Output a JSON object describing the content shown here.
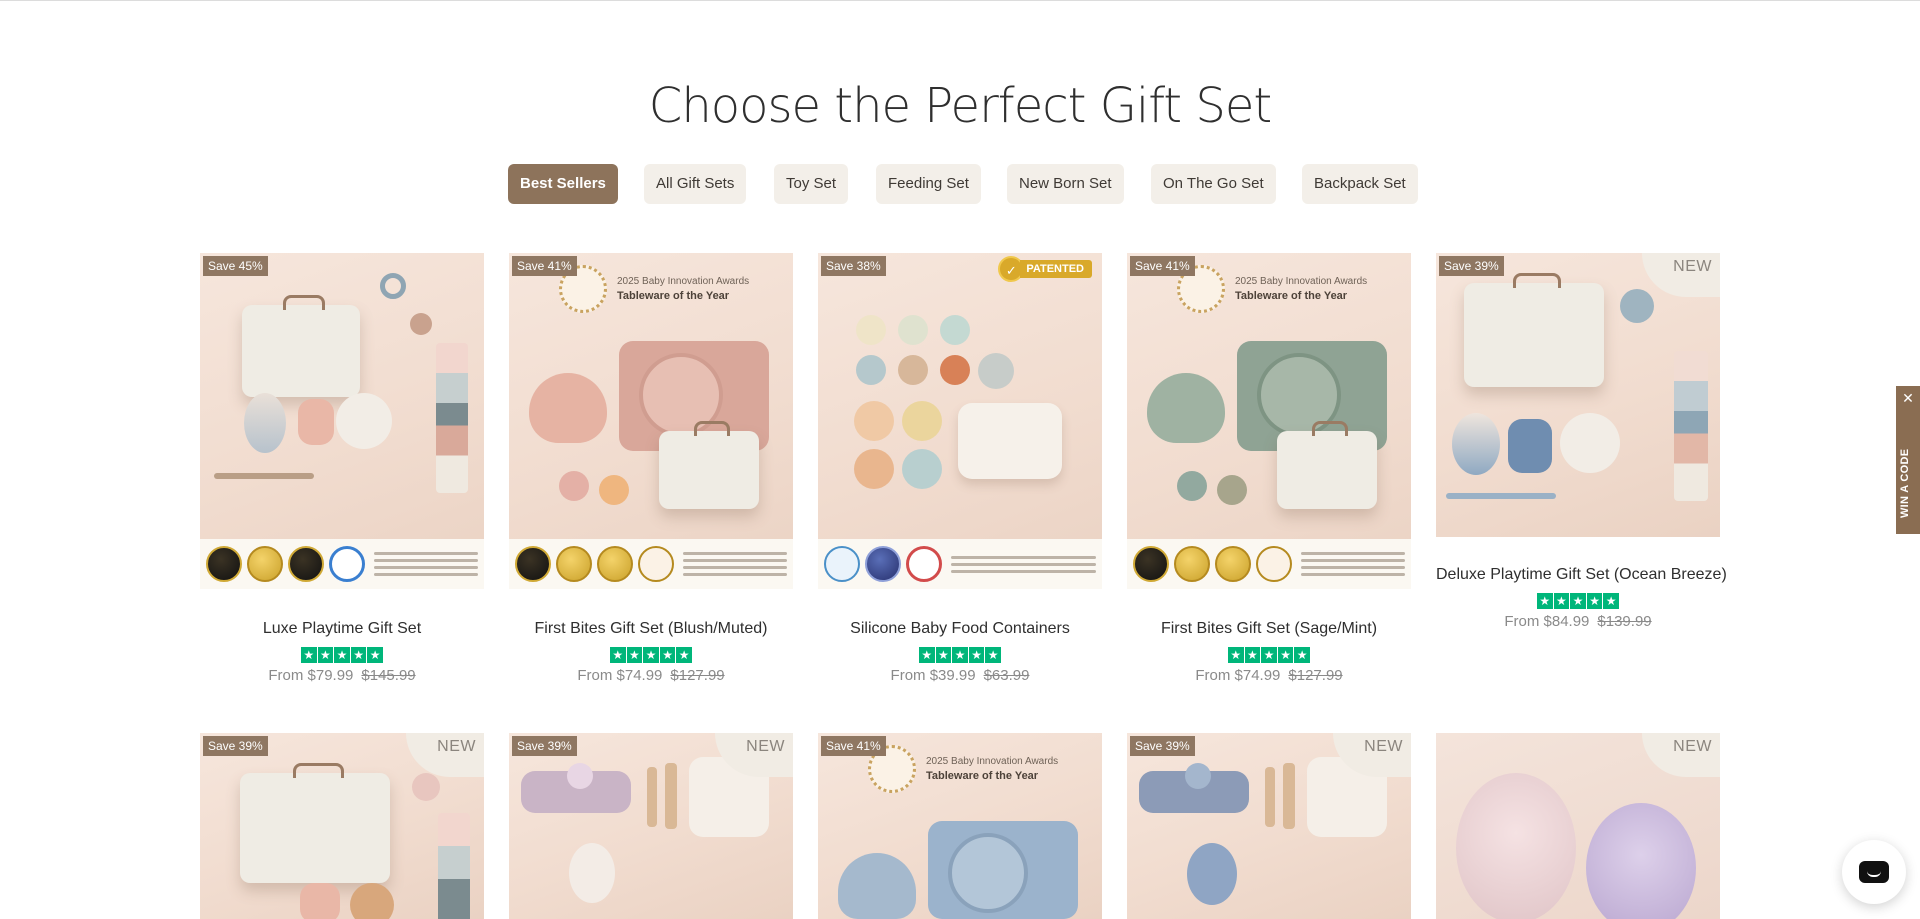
{
  "heading": "Choose the Perfect Gift Set",
  "tabs": [
    {
      "label": "Best Sellers",
      "active": true
    },
    {
      "label": "All Gift Sets",
      "active": false
    },
    {
      "label": "Toy Set",
      "active": false
    },
    {
      "label": "Feeding Set",
      "active": false
    },
    {
      "label": "New Born Set",
      "active": false
    },
    {
      "label": "On The Go Set",
      "active": false
    },
    {
      "label": "Backpack Set",
      "active": false
    }
  ],
  "products_row1": [
    {
      "badge": "Save 45%",
      "name": "Luxe Playtime Gift Set",
      "price": "From $79.99",
      "compare": "$145.99",
      "rating": 5
    },
    {
      "badge": "Save 41%",
      "name": "First Bites Gift Set (Blush/Muted)",
      "price": "From $74.99",
      "compare": "$127.99",
      "rating": 5,
      "award_title": "2025 Baby Innovation Awards",
      "award_sub": "Tableware of the Year"
    },
    {
      "badge": "Save 38%",
      "name": "Silicone Baby Food Containers",
      "price": "From $39.99",
      "compare": "$63.99",
      "rating": 5,
      "patented": "PATENTED"
    },
    {
      "badge": "Save 41%",
      "name": "First Bites Gift Set (Sage/Mint)",
      "price": "From $74.99",
      "compare": "$127.99",
      "rating": 5,
      "award_title": "2025 Baby Innovation Awards",
      "award_sub": "Tableware of the Year"
    },
    {
      "badge": "Save 39%",
      "name": "Deluxe Playtime Gift Set (Ocean Breeze)",
      "price": "From $84.99",
      "compare": "$139.99",
      "rating": 5,
      "new": "NEW"
    }
  ],
  "products_row2": [
    {
      "badge": "Save 39%",
      "new": "NEW"
    },
    {
      "badge": "Save 39%",
      "new": "NEW"
    },
    {
      "badge": "Save 41%",
      "award_title": "2025 Baby Innovation Awards",
      "award_sub": "Tableware of the Year"
    },
    {
      "badge": "Save 39%",
      "new": "NEW"
    },
    {
      "new": "NEW"
    }
  ],
  "colors": {
    "accent": "#8d735b",
    "stars": "#00b67a",
    "tab_bg": "#f3efe9"
  },
  "side_tab": {
    "label": "WIN A CODE",
    "close": "✕"
  },
  "chat": {
    "icon": "chat-bubble-icon"
  }
}
